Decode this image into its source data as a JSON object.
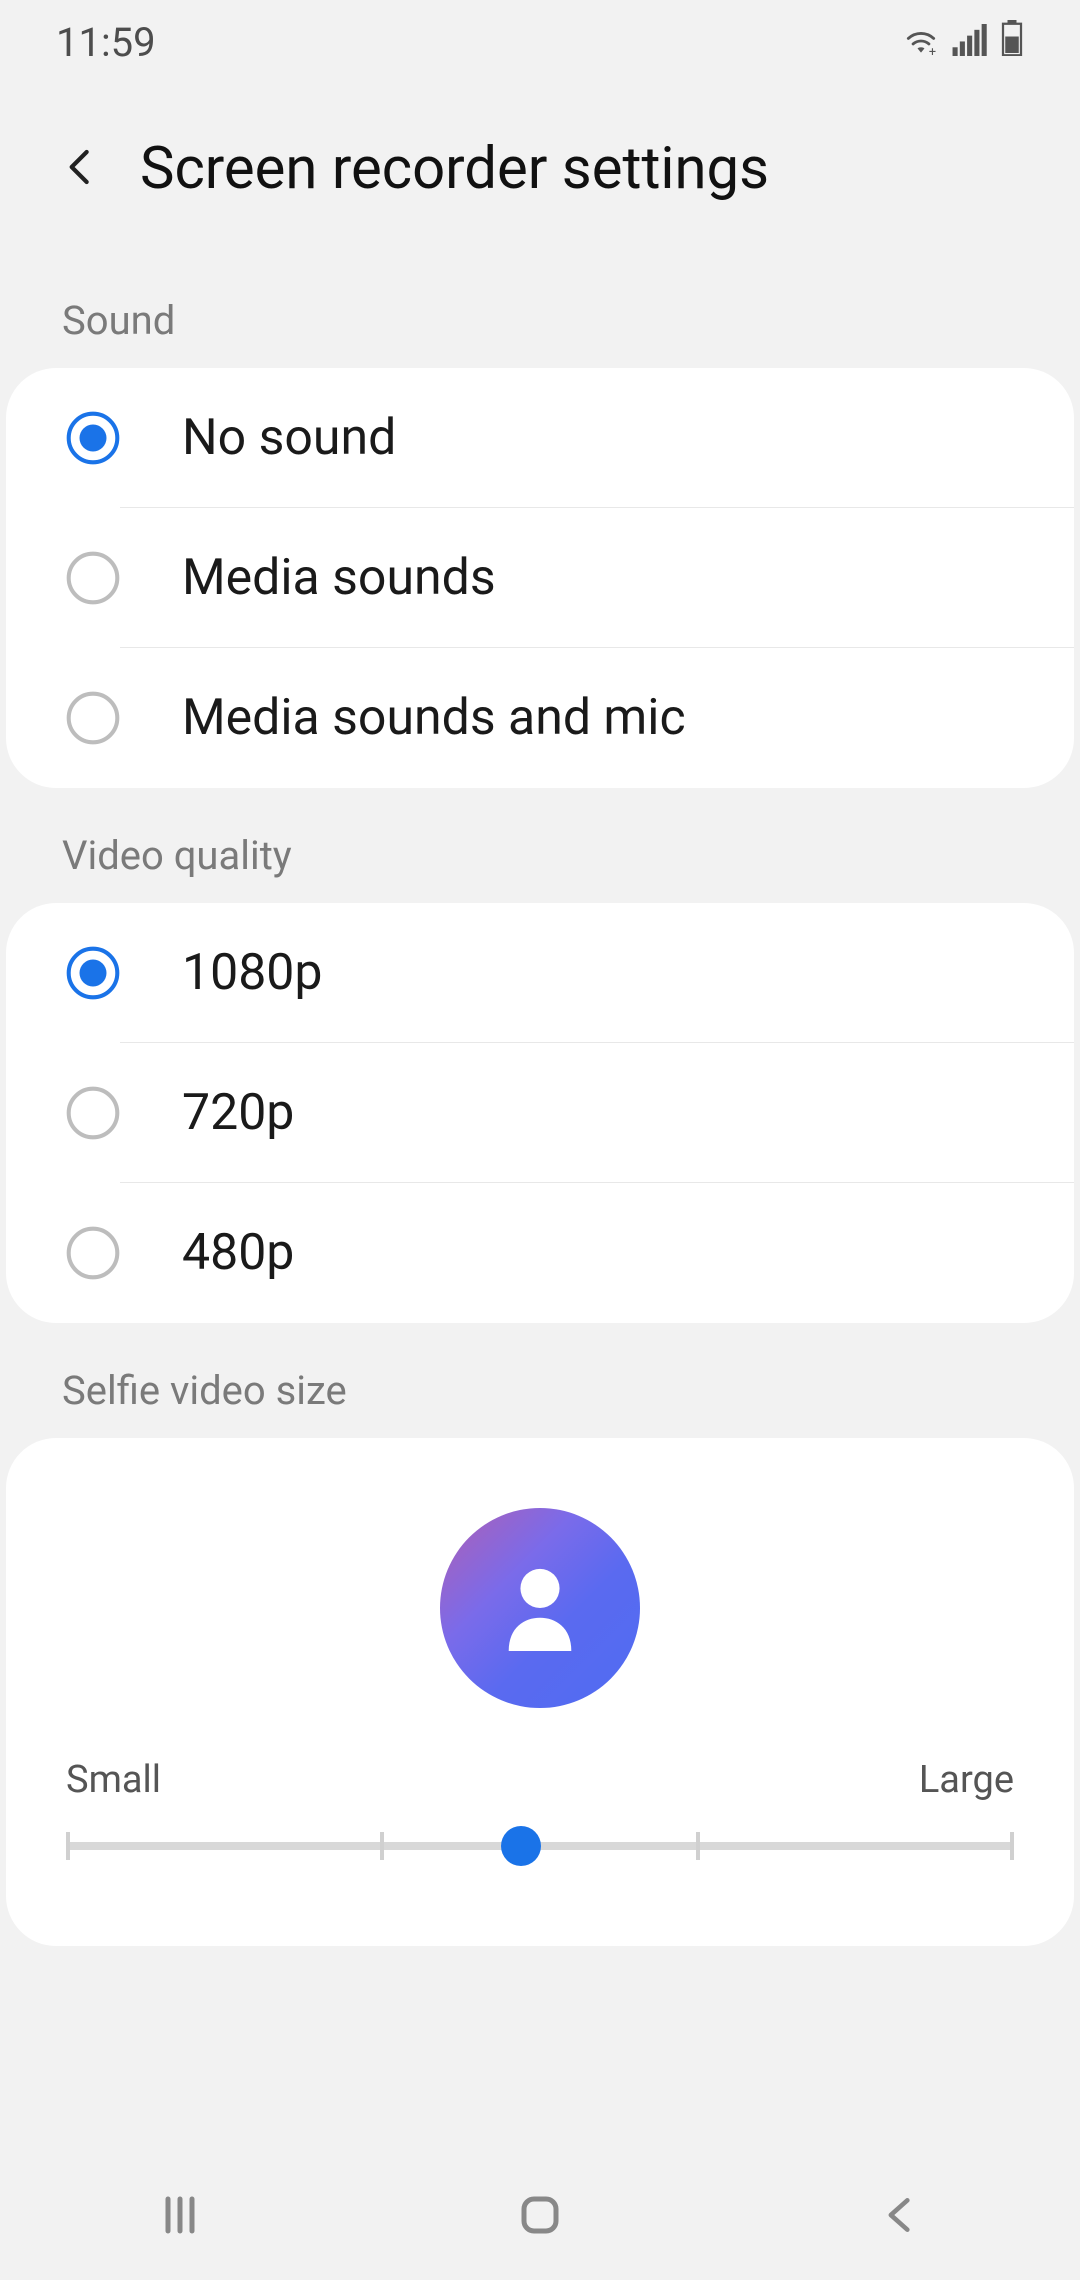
{
  "status": {
    "time": "11:59"
  },
  "header": {
    "title": "Screen recorder settings"
  },
  "sections": {
    "sound": {
      "label": "Sound",
      "options": [
        {
          "label": "No sound",
          "selected": true
        },
        {
          "label": "Media sounds",
          "selected": false
        },
        {
          "label": "Media sounds and mic",
          "selected": false
        }
      ]
    },
    "video_quality": {
      "label": "Video quality",
      "options": [
        {
          "label": "1080p",
          "selected": true
        },
        {
          "label": "720p",
          "selected": false
        },
        {
          "label": "480p",
          "selected": false
        }
      ]
    },
    "selfie": {
      "label": "Selfie video size",
      "min_label": "Small",
      "max_label": "Large",
      "steps": 4,
      "value_index": 1
    }
  },
  "colors": {
    "accent": "#1a73e8"
  }
}
